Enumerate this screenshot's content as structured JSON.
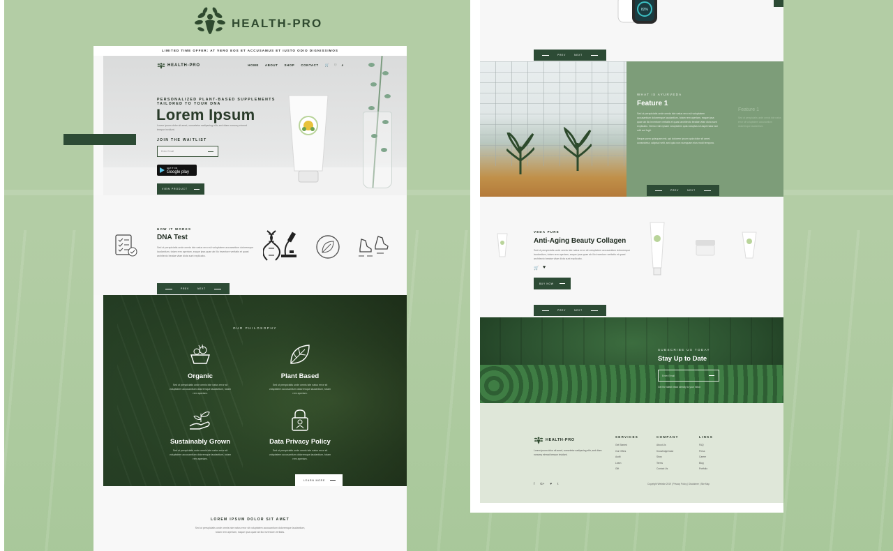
{
  "brand": {
    "name": "HEALTH-PRO"
  },
  "left_page": {
    "offer_prefix": "LIMITED TIME OFFER:",
    "offer_text": "AT VERO EOS ET ACCUSAMUS ET IUSTO ODIO DIGNISSIMOS",
    "nav": {
      "logo": "HEALTH-PRO",
      "links": [
        "HOME",
        "ABOUT",
        "SHOP",
        "CONTACT"
      ]
    },
    "hero": {
      "kicker": "PERSONALIZED PLANT-BASED SUPPLEMENTS TAILORED TO YOUR DNA",
      "title": "Lorem Ipsum",
      "desc": "Lorem ipsum dolor sit amet, consetetur sadipscing elitr, sed diam nonumy eirmod tempor invidunt.",
      "waitlist_label": "JOIN THE WAITLIST",
      "email_placeholder": "Enter Email",
      "gplay_small": "GET IT ON",
      "gplay_label": "Google play",
      "view_button": "VIEW PRODUCT"
    },
    "how": {
      "kicker": "HOW IT WORKS",
      "title": "DNA Test",
      "desc": "Sed ut perspiciatis unde omnis iste natus error sit voluptatem accusantium doloremque laudantium, totam rem aperiam, eaque ipsa quae ab illo inventore veritatis et quasi architecto beatae vitae dicta sunt explicabo.",
      "prev": "PREV",
      "next": "NEXT"
    },
    "philosophy": {
      "caption": "OUR PHILOSOPHY",
      "features": [
        {
          "title": "Organic",
          "desc": "Sed ut perspiciatis unde omnis iste natus error sit voluptatem accusantium doloremque laudantium, totam rem aperiam."
        },
        {
          "title": "Plant Based",
          "desc": "Sed ut perspiciatis unde omnis iste natus error sit voluptatem accusantium doloremque laudantium, totam rem aperiam."
        },
        {
          "title": "Sustainably Grown",
          "desc": "Sed ut perspiciatis unde omnis iste natus error sit voluptatem accusantium doloremque laudantium, totam rem aperiam."
        },
        {
          "title": "Data Privacy Policy",
          "desc": "Sed ut perspiciatis unde omnis iste natus error sit voluptatem accusantium doloremque laudantium, totam rem aperiam."
        }
      ],
      "learn_more": "LEARN MORE"
    },
    "lorem": {
      "title": "LOREM IPSUM DOLOR SIT AMET",
      "desc": "Sed ut perspiciatis unde omnis iste natus error sit voluptatem accusantium doloremque laudantium, totam rem aperiam, eaque ipsa quae ab illo inventore veritatis."
    }
  },
  "right_page": {
    "top_prev": "PREV",
    "top_next": "NEXT",
    "watch_value": "82%",
    "ayurveda": {
      "kicker": "WHAT IS AYURVEDA",
      "title": "Feature 1",
      "desc1": "Sed ut perspiciatis unde omnis iste natus error sit voluptatem accusantium doloremque laudantium, totam rem aperiam, eaque ipsa quae ab illo inventore veritatis et quasi architecto beatae vitae dicta sunt explicabo. Nemo enim ipsam voluptatem quia voluptas sit aspernatur aut odit aut fugit.",
      "desc2": "Neque porro quisquam est, qui dolorem ipsum quia dolor sit amet, consectetur, adipisci velit, sed quia non numquam eius modi tempora.",
      "ghost_title": "Feature 1",
      "ghost_desc": "Sed ut perspiciatis unde omnis iste natus error sit voluptatem accusantium doloremque laudantium.",
      "prev": "PREV",
      "next": "NEXT"
    },
    "product": {
      "kicker": "VEDA PURE",
      "title": "Anti-Aging Beauty Collagen",
      "desc": "Sed ut perspiciatis unde omnis iste natus error sit voluptatem accusantium doloremque laudantium, totam rem aperiam, eaque ipsa quae ab illo inventore veritatis et quasi architecto beatae vitae dicta sunt explicabo.",
      "buy": "BUY NOW",
      "prev": "PREV",
      "next": "NEXT"
    },
    "subscribe": {
      "kicker": "SUBSCRIBE US TODAY",
      "title": "Stay Up to Date",
      "email_placeholder": "Enter Email",
      "note": "Get the latest news directly to your inbox"
    },
    "footer": {
      "logo": "HEALTH-PRO",
      "desc": "Lorem ipsum dolor sit amet, consetetur sadipscing elitr, sed diam nonumy eirmod tempor invidunt.",
      "services_title": "SERVICES",
      "services": [
        "Get Started",
        "Our Offers",
        "Audit",
        "Learn",
        "Gift"
      ],
      "company_title": "COMPANY",
      "company": [
        "About Us",
        "Knowledge base",
        "Story",
        "Terms",
        "Contact Us"
      ],
      "links_title": "LINKS",
      "links": [
        "FAQ",
        "Press",
        "Career",
        "Blog",
        "Portfolio"
      ],
      "social": [
        "f",
        "G+",
        "♥",
        "t"
      ],
      "legal": "Copyright Website 2019  |  Privacy Policy  |  Disclaimer  |  Site Map"
    }
  }
}
